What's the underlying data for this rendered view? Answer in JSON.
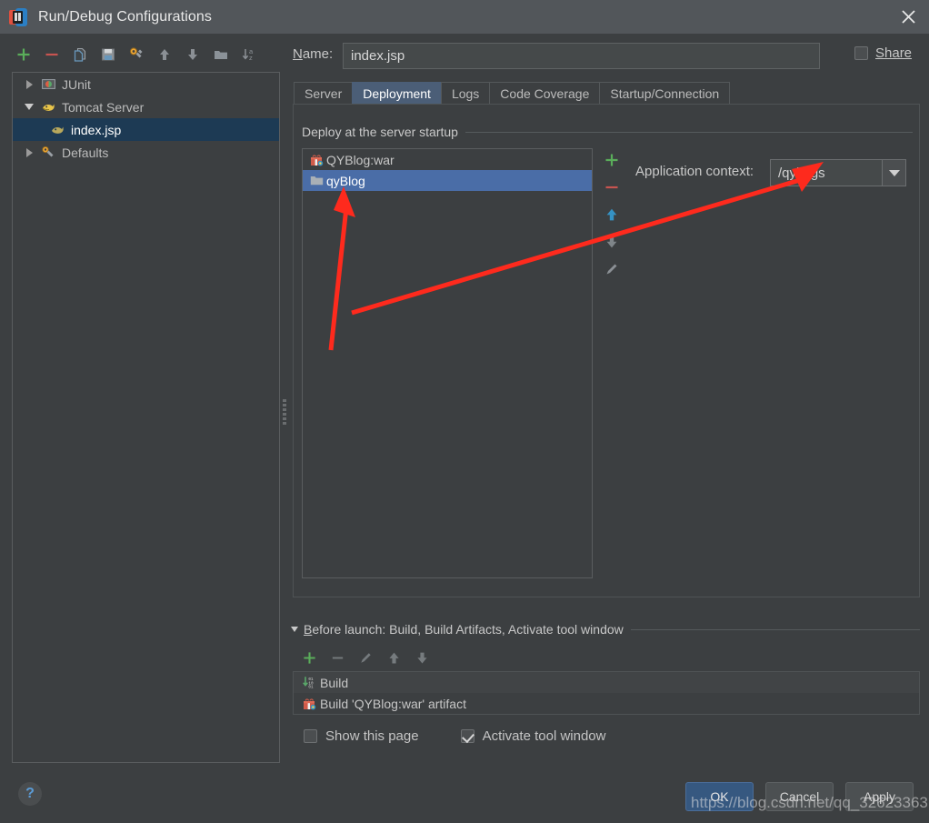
{
  "window": {
    "title": "Run/Debug Configurations",
    "icon": "intellij-idea-icon",
    "close_label": "✕"
  },
  "left_toolbar": {
    "buttons": [
      {
        "name": "add-configuration-button",
        "icon": "plus-icon",
        "tooltip": "Add New Configuration"
      },
      {
        "name": "remove-configuration-button",
        "icon": "minus-icon",
        "tooltip": "Remove Configuration"
      },
      {
        "name": "copy-configuration-button",
        "icon": "copy-icon",
        "tooltip": "Copy Configuration"
      },
      {
        "name": "save-configuration-button",
        "icon": "save-icon",
        "tooltip": "Save Configuration"
      },
      {
        "name": "edit-defaults-button",
        "icon": "wrench-icon",
        "tooltip": "Edit Defaults"
      },
      {
        "name": "move-up-button",
        "icon": "arrow-up-icon",
        "tooltip": "Move Up"
      },
      {
        "name": "move-down-button",
        "icon": "arrow-down-icon",
        "tooltip": "Move Down"
      },
      {
        "name": "create-folder-button",
        "icon": "folder-icon",
        "tooltip": "Create New Folder"
      },
      {
        "name": "sort-alphabetically-button",
        "icon": "sort-az-icon",
        "tooltip": "Sort Configurations"
      }
    ]
  },
  "tree": {
    "items": [
      {
        "label": "JUnit",
        "icon": "junit-icon",
        "expander": "collapsed",
        "level": 0,
        "selected": false
      },
      {
        "label": "Tomcat Server",
        "icon": "tomcat-icon",
        "expander": "expanded",
        "level": 0,
        "selected": false
      },
      {
        "label": "index.jsp",
        "icon": "tomcat-icon",
        "expander": "none",
        "level": 1,
        "selected": true
      },
      {
        "label": "Defaults",
        "icon": "defaults-icon",
        "expander": "collapsed",
        "level": 0,
        "selected": false
      }
    ]
  },
  "name_row": {
    "label": "Name:",
    "label_mnemonic": "N",
    "label_rest": "ame:",
    "value": "index.jsp",
    "placeholder": "",
    "share_label": "Share",
    "share_checked": false
  },
  "tabs": [
    {
      "label": "Server",
      "active": false
    },
    {
      "label": "Deployment",
      "active": true
    },
    {
      "label": "Logs",
      "active": false
    },
    {
      "label": "Code Coverage",
      "active": false
    },
    {
      "label": "Startup/Connection",
      "active": false
    }
  ],
  "deployment": {
    "section_title": "Deploy at the server startup",
    "artifacts": [
      {
        "label": "QYBlog:war",
        "icon": "artifact-war-icon",
        "selected": false
      },
      {
        "label": "qyBlog",
        "icon": "folder-icon",
        "selected": true
      }
    ],
    "list_toolbar": [
      {
        "name": "add-artifact-button",
        "icon": "plus-icon",
        "enabled": true
      },
      {
        "name": "remove-artifact-button",
        "icon": "minus-icon",
        "enabled": true
      },
      {
        "name": "move-artifact-up-button",
        "icon": "arrow-up-icon",
        "enabled": true
      },
      {
        "name": "move-artifact-down-button",
        "icon": "arrow-down-icon",
        "enabled": false
      },
      {
        "name": "edit-artifact-button",
        "icon": "pencil-icon",
        "enabled": false
      }
    ],
    "application_context": {
      "label": "Application context:",
      "value": "/qyimgs",
      "dropdown_icon": "chevron-down-icon"
    }
  },
  "before_launch": {
    "header": "Before launch: Build, Build Artifacts, Activate tool window",
    "header_mnemonic": "B",
    "header_rest": "efore launch: Build, Build Artifacts, Activate tool window",
    "toolbar": [
      {
        "name": "add-task-button",
        "icon": "plus-icon",
        "enabled": true
      },
      {
        "name": "remove-task-button",
        "icon": "minus-icon",
        "enabled": false
      },
      {
        "name": "edit-task-button",
        "icon": "pencil-icon",
        "enabled": false
      },
      {
        "name": "task-move-up-button",
        "icon": "arrow-up-icon",
        "enabled": false
      },
      {
        "name": "task-move-down-button",
        "icon": "arrow-down-icon",
        "enabled": false
      }
    ],
    "tasks": [
      {
        "label": "Build",
        "icon": "build-icon"
      },
      {
        "label": "Build 'QYBlog:war' artifact",
        "icon": "artifact-war-icon"
      }
    ],
    "show_this_page": {
      "label": "Show this page",
      "checked": false
    },
    "activate_tool_window": {
      "label": "Activate tool window",
      "checked": true
    }
  },
  "footer": {
    "help_label": "?",
    "ok_label": "OK",
    "cancel_label": "Cancel",
    "apply_label": "Apply"
  },
  "watermark": {
    "text": "https://blog.csdn.net/qq_32623363"
  },
  "colors": {
    "background": "#3c3f41",
    "titlebar": "#52565a",
    "tree_selection": "#1d3a54",
    "list_selection": "#4a6da7",
    "tab_active": "#4b5e77",
    "primary_button": "#365880",
    "annotation_red": "#fe2a1d",
    "accent_green": "#5aad5a",
    "accent_blue": "#3592c4"
  }
}
